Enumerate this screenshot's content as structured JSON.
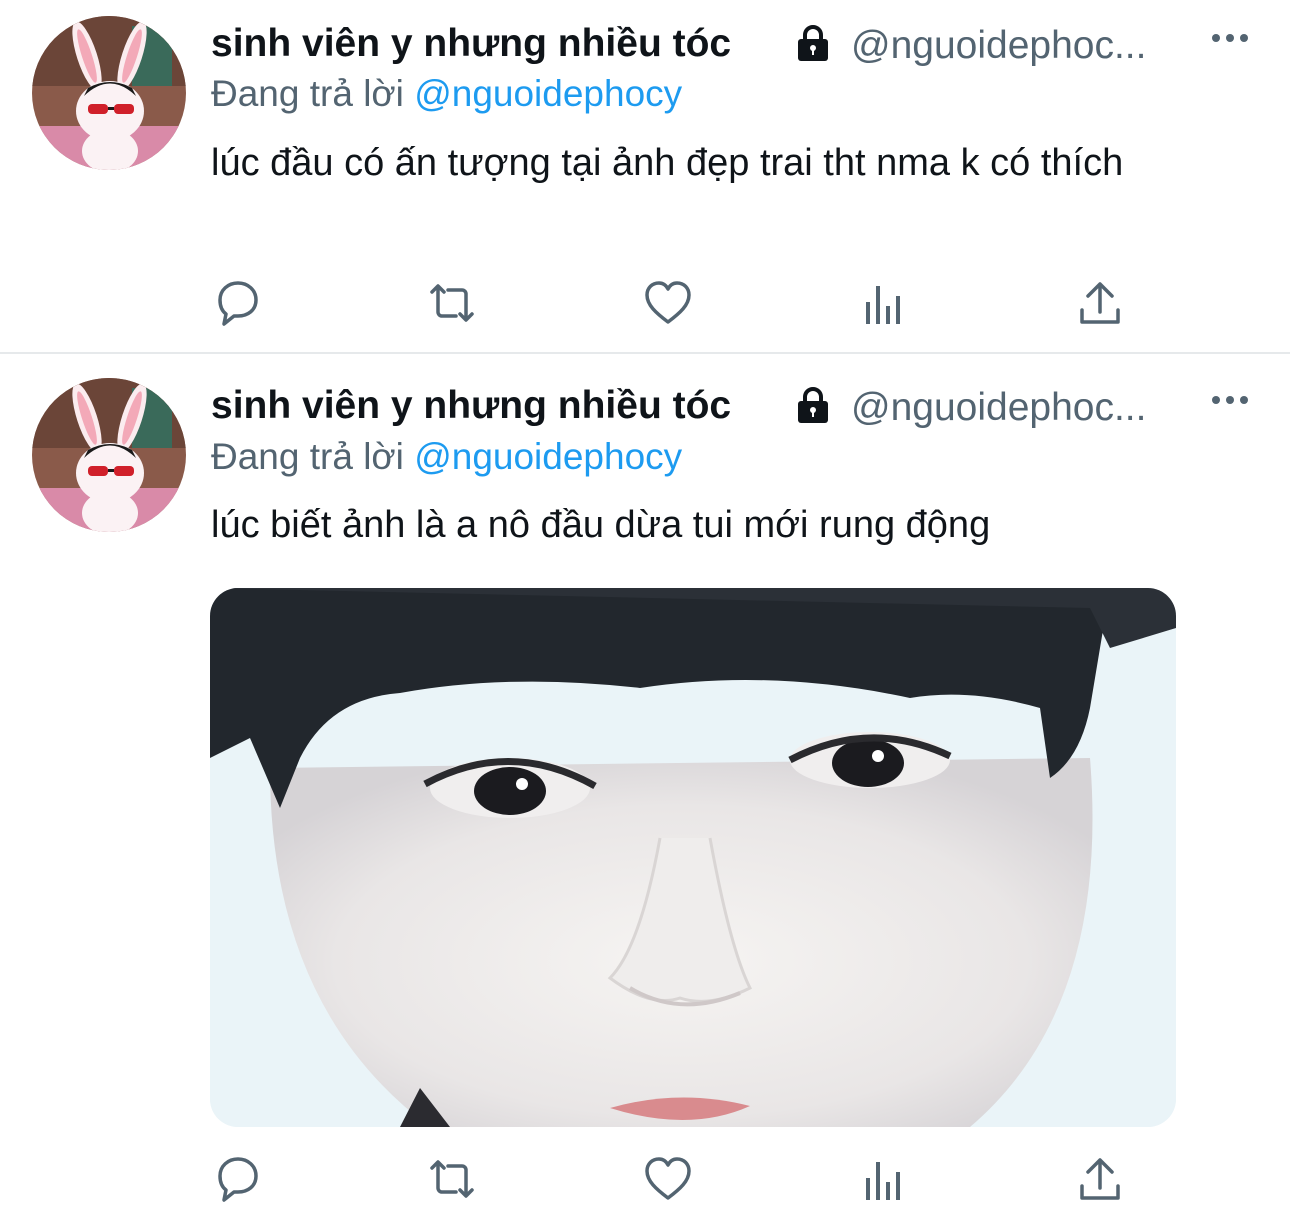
{
  "tweets": [
    {
      "author_name": "sinh viên y nhưng nhiều tóc",
      "handle": "@nguoidephoc...",
      "replying_prefix": "Đang trả lời",
      "replying_to": "@nguoidephocy",
      "text": "lúc đầu có ấn tượng tại ảnh đẹp trai tht nma k có thích",
      "has_media": false
    },
    {
      "author_name": "sinh viên y nhưng nhiều tóc",
      "handle": "@nguoidephoc...",
      "replying_prefix": "Đang trả lời",
      "replying_to": "@nguoidephocy",
      "text": "lúc biết ảnh là a nô đầu dừa tui mới rung động",
      "has_media": true
    }
  ],
  "icons": {
    "lock": "lock-icon",
    "more": "more-icon",
    "reply": "reply-icon",
    "retweet": "retweet-icon",
    "like": "like-icon",
    "analytics": "analytics-icon",
    "share": "share-icon"
  },
  "colors": {
    "text_primary": "#0f1419",
    "text_secondary": "#536471",
    "link": "#1d9bf0",
    "divider": "#e6e9eb"
  }
}
